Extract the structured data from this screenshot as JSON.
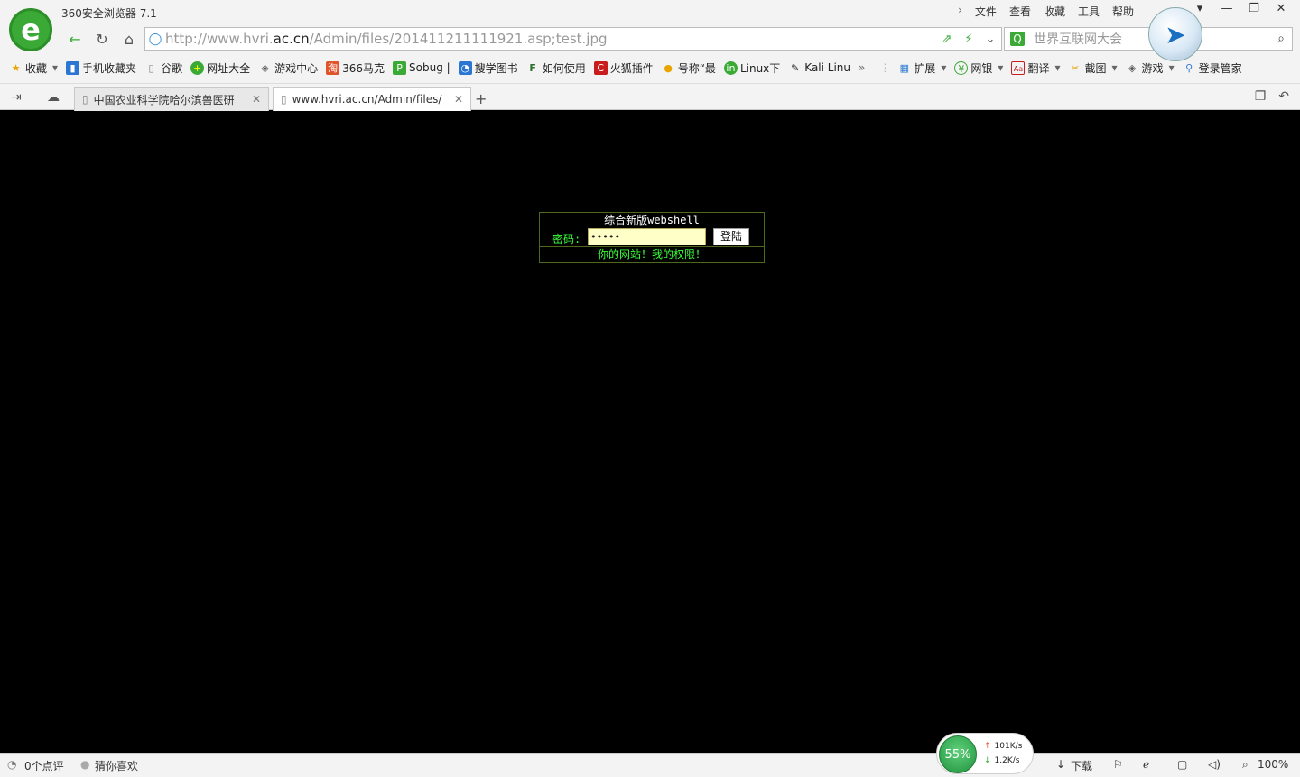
{
  "app": {
    "title": "360安全浏览器 7.1"
  },
  "menu": {
    "items": [
      "文件",
      "查看",
      "收藏",
      "工具",
      "帮助"
    ]
  },
  "address": {
    "url_prefix": "http://www.hvri.",
    "url_domain": "ac.cn",
    "url_path": "/Admin/files/201411211111921.asp;test.jpg"
  },
  "search": {
    "placeholder": "世界互联网大会"
  },
  "bookmarks": [
    "收藏",
    "手机收藏夹",
    "谷歌",
    "网址大全",
    "游戏中心",
    "366马克",
    "Sobug |",
    "搜学图书",
    "如何使用",
    "火狐插件",
    "号称“最",
    "Linux下",
    "Kali Linu"
  ],
  "extensions": [
    "扩展",
    "网银",
    "翻译",
    "截图",
    "游戏",
    "登录管家"
  ],
  "tabs": [
    {
      "label": "中国农业科学院哈尔滨兽医研"
    },
    {
      "label": "www.hvri.ac.cn/Admin/files/"
    }
  ],
  "shell": {
    "title": "综合新版webshell",
    "password_label": "密码:",
    "password_value": "•••••",
    "login_button": "登陆",
    "footer": "你的网站！我的权限！"
  },
  "status": {
    "comments": "0个点评",
    "recommend": "猜你喜欢",
    "download": "下载",
    "zoom": "100%",
    "cpu": "55%",
    "upload_speed": "101K/s",
    "download_speed": "1.2K/s"
  }
}
